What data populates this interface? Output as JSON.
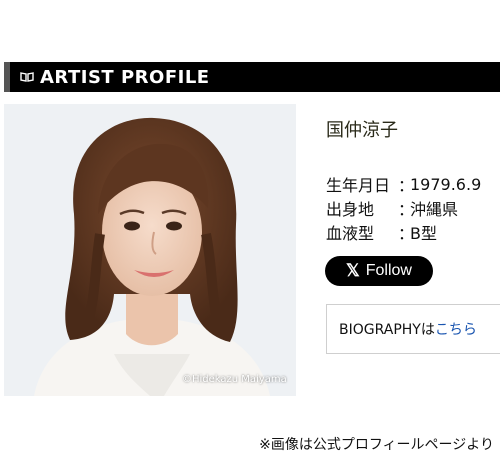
{
  "header": {
    "title": "ARTIST PROFILE",
    "icon": "book-icon"
  },
  "photo": {
    "credit": "©Hidekazu Maiyama"
  },
  "artist": {
    "name": "国仲涼子"
  },
  "info": [
    {
      "key": "生年月日",
      "sep": "：",
      "value": "1979.6.9"
    },
    {
      "key": "出身地",
      "sep": "：",
      "value": "沖縄県"
    },
    {
      "key": "血液型",
      "sep": "：",
      "value": "B型"
    }
  ],
  "social": {
    "follow_label": "Follow",
    "glyph": "𝕏"
  },
  "bio": {
    "prefix": "BIOGRAPHYは",
    "link_label": "こちら"
  },
  "footnote": "※画像は公式プロフィールページより",
  "colors": {
    "header_bg": "#000000",
    "link": "#1a55b0",
    "name": "#2a2a1a"
  }
}
